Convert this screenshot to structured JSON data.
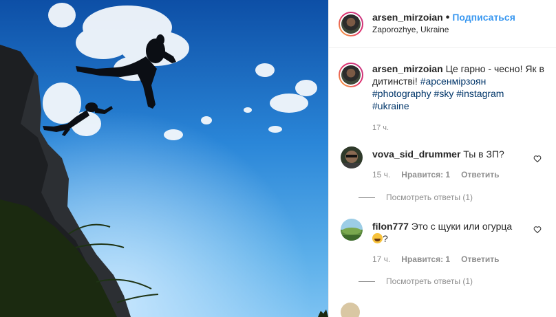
{
  "header": {
    "username": "arsen_mirzoian",
    "separator": "•",
    "follow_label": "Подписаться",
    "location": "Zaporozhye, Ukraine"
  },
  "caption": {
    "username": "arsen_mirzoian",
    "text": "Це гарно - чесно! Як в дитинстві!",
    "hashtags": [
      "#арсенмірзоян",
      "#photography",
      "#sky",
      "#instagram",
      "#ukraine"
    ],
    "time": "17 ч."
  },
  "comments": [
    {
      "username": "vova_sid_drummer",
      "text": "Ты в ЗП?",
      "time": "15 ч.",
      "likes_label": "Нравится: 1",
      "reply_label": "Ответить",
      "view_replies": "Посмотреть ответы (1)"
    },
    {
      "username": "filon777",
      "text": "Это с щуки или огурца",
      "text_suffix": "?",
      "time": "17 ч.",
      "likes_label": "Нравится: 1",
      "reply_label": "Ответить",
      "view_replies": "Посмотреть ответы (1)"
    }
  ],
  "colors": {
    "link_blue": "#3897f0",
    "hashtag": "#003569",
    "muted": "#8e8e8e",
    "sky": "#1d6fc4"
  },
  "icons": [
    "heart-icon",
    "laughing-emoji-icon"
  ]
}
